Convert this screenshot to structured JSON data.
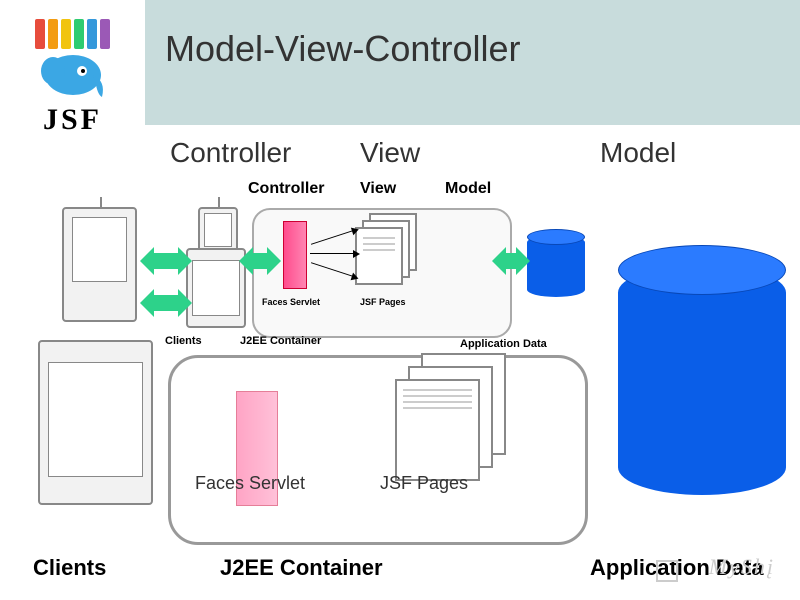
{
  "header": {
    "title": "Model-View-Controller",
    "logo_text": "JSF",
    "logo_bar_colors": [
      "#e74c3c",
      "#f39c12",
      "#f1c40f",
      "#2ecc71",
      "#3498db",
      "#9b59b6"
    ]
  },
  "columns": {
    "controller": "Controller",
    "view": "View",
    "model": "Model"
  },
  "inner": {
    "controller": "Controller",
    "view": "View",
    "model": "Model",
    "faces_servlet": "Faces Servlet",
    "jsf_pages": "JSF Pages",
    "clients": "Clients",
    "j2ee_container": "J2EE Container",
    "application_data": "Application Data"
  },
  "outer": {
    "faces_servlet": "Faces Servlet",
    "jsf_pages": "JSF Pages",
    "clients": "Clients",
    "j2ee_container": "J2EE Container",
    "application_data": "Application Data"
  },
  "watermark": "MyShį"
}
